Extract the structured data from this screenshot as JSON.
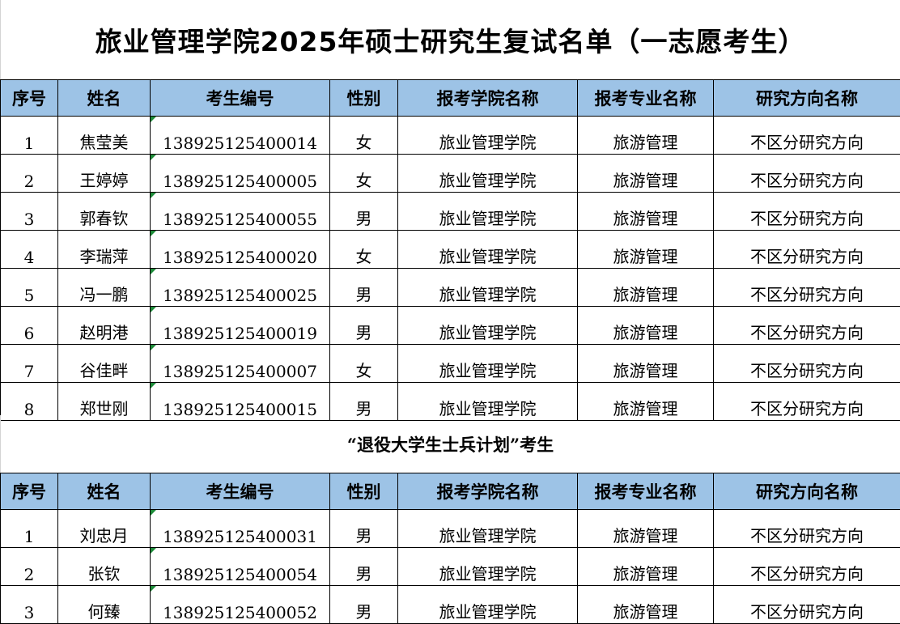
{
  "title": "旅业管理学院2025年硕士研究生复试名单（一志愿考生）",
  "headers": [
    "序号",
    "姓名",
    "考生编号",
    "性别",
    "报考学院名称",
    "报考专业名称",
    "研究方向名称"
  ],
  "section1": {
    "rows": [
      [
        "1",
        "焦莹美",
        "138925125400014",
        "女",
        "旅业管理学院",
        "旅游管理",
        "不区分研究方向"
      ],
      [
        "2",
        "王婷婷",
        "138925125400005",
        "女",
        "旅业管理学院",
        "旅游管理",
        "不区分研究方向"
      ],
      [
        "3",
        "郭春钦",
        "138925125400055",
        "男",
        "旅业管理学院",
        "旅游管理",
        "不区分研究方向"
      ],
      [
        "4",
        "李瑞萍",
        "138925125400020",
        "女",
        "旅业管理学院",
        "旅游管理",
        "不区分研究方向"
      ],
      [
        "5",
        "冯一鹏",
        "138925125400025",
        "男",
        "旅业管理学院",
        "旅游管理",
        "不区分研究方向"
      ],
      [
        "6",
        "赵明港",
        "138925125400019",
        "男",
        "旅业管理学院",
        "旅游管理",
        "不区分研究方向"
      ],
      [
        "7",
        "谷佳畔",
        "138925125400007",
        "女",
        "旅业管理学院",
        "旅游管理",
        "不区分研究方向"
      ],
      [
        "8",
        "郑世刚",
        "138925125400015",
        "男",
        "旅业管理学院",
        "旅游管理",
        "不区分研究方向"
      ]
    ]
  },
  "subtitle": "“退役大学生士兵计划”考生",
  "section2": {
    "rows": [
      [
        "1",
        "刘忠月",
        "138925125400031",
        "男",
        "旅业管理学院",
        "旅游管理",
        "不区分研究方向"
      ],
      [
        "2",
        "张钦",
        "138925125400054",
        "男",
        "旅业管理学院",
        "旅游管理",
        "不区分研究方向"
      ],
      [
        "3",
        "何臻",
        "138925125400052",
        "男",
        "旅业管理学院",
        "旅游管理",
        "不区分研究方向"
      ]
    ]
  },
  "colors": {
    "header_bg": "#9dc3e6",
    "cell_marker": "#1e8c3a",
    "border": "#000000"
  }
}
